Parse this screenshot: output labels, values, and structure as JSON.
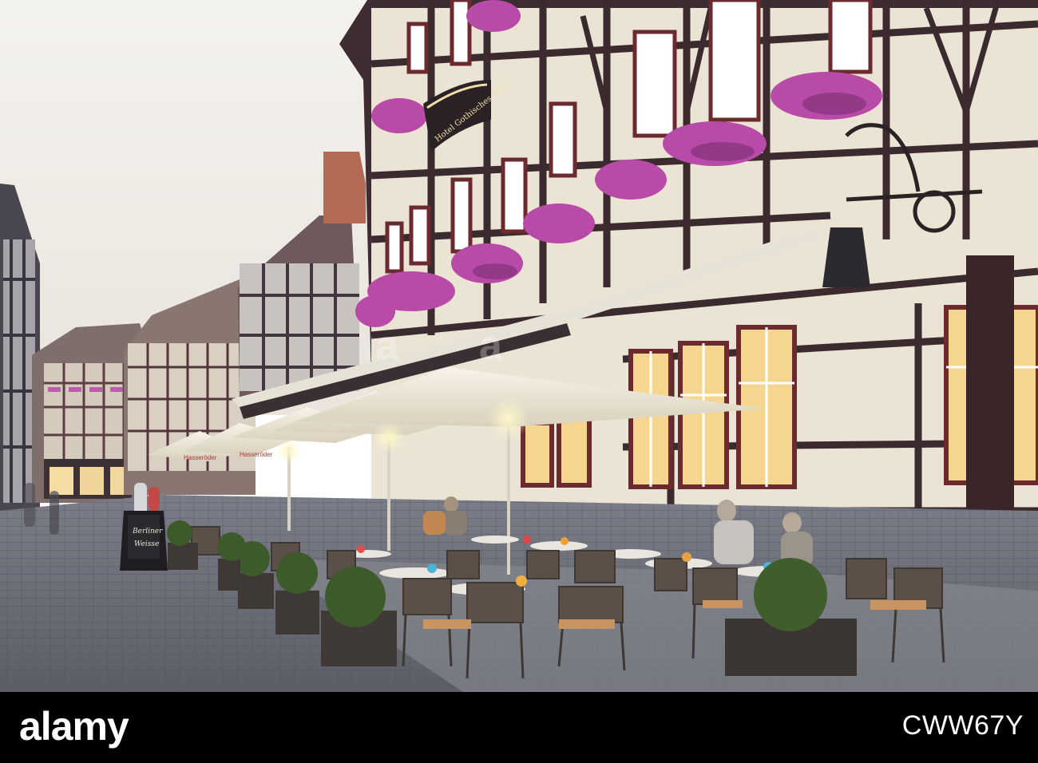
{
  "scene": {
    "description_colors": {
      "sky": "#f1eee9",
      "cobblestone": "#6d6f7a",
      "timber_frame": "#3b2a2e",
      "plaster": "#ece5d6",
      "window_glow": "#f6d58f",
      "flowers": "#b84aa8",
      "umbrella": "#f4efe2",
      "chair": "#5a5048",
      "planter": "#3f3a35",
      "boxwood": "#3c5a2a"
    },
    "signs": {
      "hotel_sign": "Hotel Gothisches Haus",
      "sandwich_board_line1": "Berliner",
      "sandwich_board_line2": "Weisse",
      "umbrella_brand_1": "Hasseröder",
      "umbrella_brand_2": "Hasseröder"
    }
  },
  "footer": {
    "logo": "alamy",
    "image_id": "CWW67Y",
    "background": "#000000",
    "text_color": "#ffffff"
  },
  "watermark": {
    "text": "a"
  }
}
